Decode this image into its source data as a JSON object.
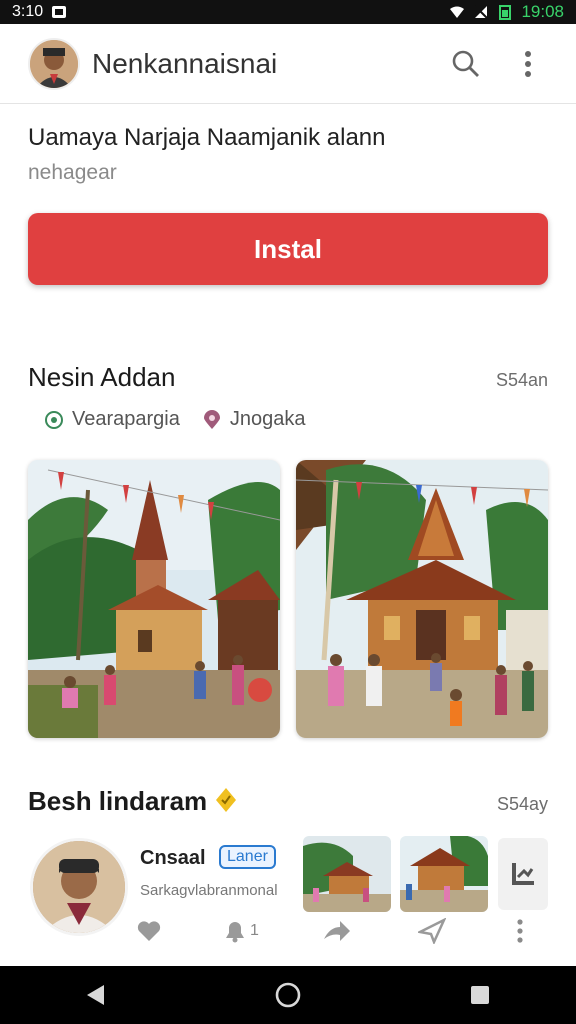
{
  "status_bar": {
    "time_left": "3:10",
    "time_right": "19:08"
  },
  "app_bar": {
    "title": "Nenkannaisnai",
    "icons": [
      "avatar",
      "search-icon",
      "more-vert-icon"
    ]
  },
  "app_info": {
    "name": "Uamaya Narjaja Naamjanik alann",
    "subtitle": "nehagear"
  },
  "install": {
    "label": "Instal",
    "color": "#e04040"
  },
  "section1": {
    "title": "Nesin Addan",
    "meta": "S54an",
    "chips": [
      {
        "label": "Vearapargia",
        "icon": "location-pin-icon"
      },
      {
        "label": "Jnogaka",
        "icon": "pin-icon"
      }
    ]
  },
  "section2": {
    "title": "Besh lindaram",
    "badge_icon": "verified-icon",
    "meta": "S54ay",
    "review": {
      "name": "Cnsaal",
      "badge": "Laner",
      "text": "Sarkagvlabranmonal"
    },
    "actions": [
      {
        "icon": "heart-icon",
        "count": ""
      },
      {
        "icon": "bell-icon",
        "count": "1"
      },
      {
        "icon": "share-icon",
        "count": ""
      },
      {
        "icon": "send-icon",
        "count": ""
      },
      {
        "icon": "more-vert-icon",
        "count": ""
      }
    ]
  },
  "nav_bar": [
    "back-icon",
    "home-icon",
    "recents-icon"
  ],
  "colors": {
    "accent": "#e04040",
    "status_green": "#39d36a"
  }
}
